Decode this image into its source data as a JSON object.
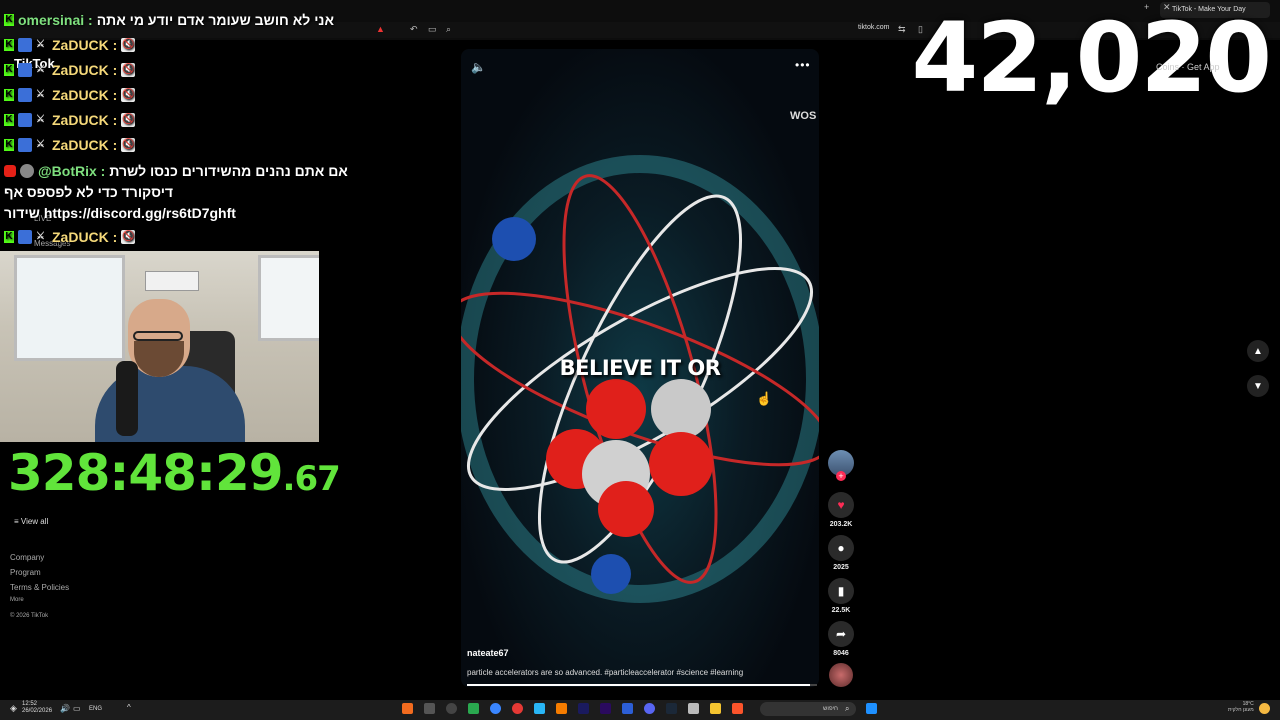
{
  "browser": {
    "tab_title": "TikTok - Make Your Day",
    "url": "tiktok.com"
  },
  "stream_overlay": {
    "viewer_count": "42,020",
    "coins_label": "Coins · Get App",
    "timer_main": "328:48:29",
    "timer_fraction": ".67"
  },
  "chat": {
    "messages": [
      {
        "user": "omersinai :",
        "text": "אני לא חושב שעומר אדם יודע מי אתה"
      },
      {
        "user": "ZaDUCK :",
        "text": ""
      },
      {
        "user": "ZaDUCK :",
        "text": ""
      },
      {
        "user": "ZaDUCK :",
        "text": ""
      },
      {
        "user": "ZaDUCK :",
        "text": ""
      },
      {
        "user": "ZaDUCK :",
        "text": ""
      },
      {
        "user": "@BotRix :",
        "text": "אם אתם נהנים מהשידורים כנסו לשרת"
      },
      {
        "user": "",
        "text": "דיסקורד כדי לא לפספס אף"
      },
      {
        "user": "",
        "text": "שידור https://discord.gg/rs6tD7ghft"
      },
      {
        "user": "ZaDUCK :",
        "text": ""
      }
    ],
    "behind_text": [
      "TikTok",
      "LIVE",
      "Messages"
    ]
  },
  "left_nav": {
    "view_all": "View all",
    "footer_links": [
      "Company",
      "Program",
      "Terms & Policies",
      "More"
    ],
    "copyright": "© 2026 TikTok"
  },
  "video": {
    "caption": "BELIEVE IT OR",
    "author": "nateate67",
    "description": "particle accelerators are so advanced. #particleaccelerator #science #learning",
    "watermark": "WOS",
    "progress": 0.98
  },
  "actions": {
    "likes": "203.2K",
    "comments": "2025",
    "saves": "22.5K",
    "shares": "8046"
  },
  "taskbar": {
    "time": "12:52",
    "date": "26/02/2026",
    "language": "ENG",
    "search_placeholder": "חיפוש",
    "weather": "18°C",
    "weather_desc": "מעונן חלקית"
  }
}
